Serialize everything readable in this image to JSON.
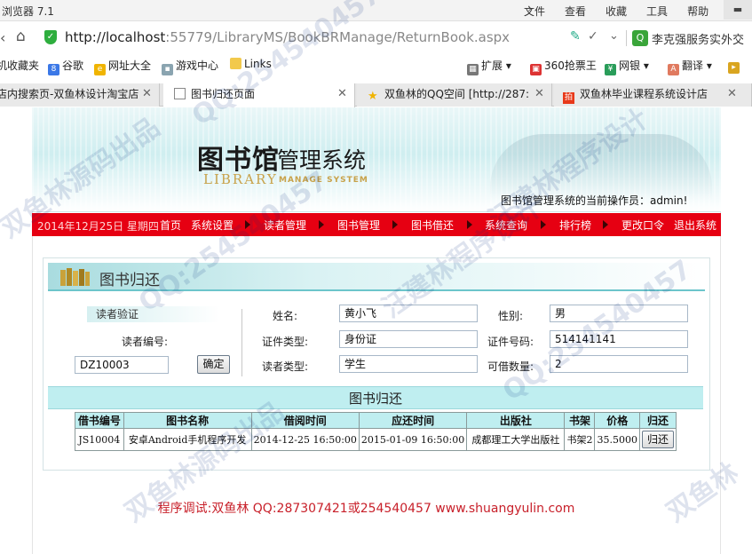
{
  "browser": {
    "title": "浏览器 7.1",
    "menus": [
      "文件",
      "查看",
      "收藏",
      "工具",
      "帮助"
    ],
    "url_host": "http://localhost",
    "url_path": ":55779/LibraryMS/BookBRManage/ReturnBook.aspx",
    "search_text": "李克强服务实外交",
    "bookmarks": [
      "机收藏夹",
      "谷歌",
      "网址大全",
      "游戏中心",
      "Links",
      "扩展",
      "360抢票王",
      "网银",
      "翻译"
    ],
    "tabs": [
      {
        "label": "店内搜索页-双鱼林设计淘宝店",
        "active": false
      },
      {
        "label": "图书归还页面",
        "active": true
      },
      {
        "label": "双鱼林的QQ空间 [http://287:",
        "active": false
      },
      {
        "label": "双鱼林毕业课程系统设计店",
        "active": false
      }
    ]
  },
  "header": {
    "logo_cn": "图书馆",
    "logo_sys": "管理系统",
    "logo_en": "LIBRARY",
    "logo_en2": "MANAGE SYSTEM",
    "operator_text": "图书馆管理系统的当前操作员：admin!"
  },
  "nav": {
    "date": "2014年12月25日 星期四",
    "items": [
      "首页",
      "系统设置",
      "读者管理",
      "图书管理",
      "图书借还",
      "系统查询",
      "排行榜",
      "更改口令",
      "退出系统"
    ]
  },
  "panel": {
    "title": "图书归还",
    "verify_label": "读者验证",
    "reader_no_label": "读者编号:",
    "reader_no_value": "DZ10003",
    "confirm_button": "确定",
    "name_label": "姓名:",
    "name_value": "黄小飞",
    "gender_label": "性别:",
    "gender_value": "男",
    "id_type_label": "证件类型:",
    "id_type_value": "身份证",
    "id_no_label": "证件号码:",
    "id_no_value": "514141141",
    "reader_type_label": "读者类型:",
    "reader_type_value": "学生",
    "borrow_limit_label": "可借数量:",
    "borrow_limit_value": "2",
    "section_title": "图书归还"
  },
  "table": {
    "headers": [
      "借书编号",
      "图书名称",
      "借阅时间",
      "应还时间",
      "出版社",
      "书架",
      "价格",
      "归还"
    ],
    "rows": [
      {
        "borrow_no": "JS10004",
        "book_name": "安卓Android手机程序开发",
        "borrow_time": "2014-12-25 16:50:00",
        "due_time": "2015-01-09 16:50:00",
        "publisher": "成都理工大学出版社",
        "shelf": "书架2",
        "price": "35.5000",
        "action": "归还"
      }
    ]
  },
  "footer": {
    "text": "程序调试:双鱼林 QQ:287307421或254540457 www.shuangyulin.com"
  },
  "watermarks": [
    "双鱼林源码出品",
    "QQ:254540457",
    "汪建林程序设计",
    "双鱼林源码出品",
    "QQ:254540457",
    "汪建林程序设计",
    "QQ:254540457",
    "双鱼林"
  ]
}
